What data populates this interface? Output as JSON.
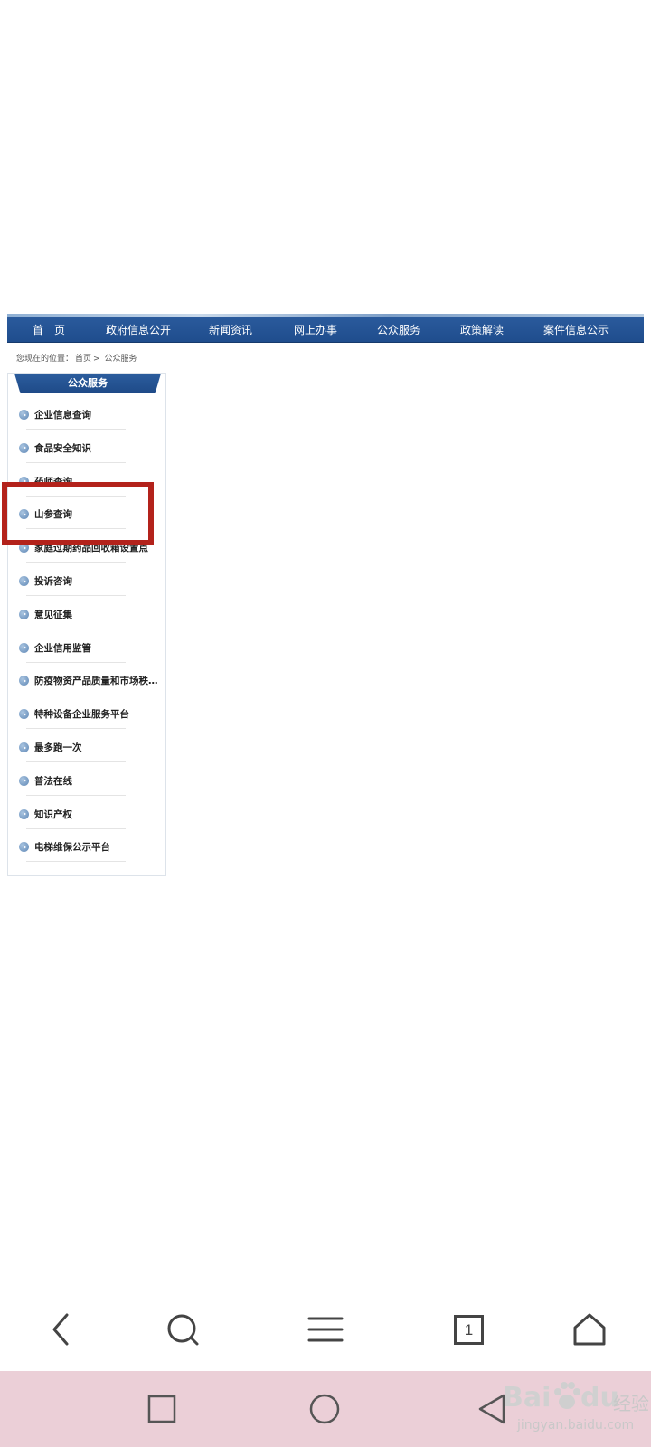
{
  "nav": {
    "items": [
      {
        "label": "首　页",
        "center": 54
      },
      {
        "label": "政府信息公开",
        "center": 153
      },
      {
        "label": "新闻资讯",
        "center": 255
      },
      {
        "label": "网上办事",
        "center": 349
      },
      {
        "label": "公众服务",
        "center": 441
      },
      {
        "label": "政策解读",
        "center": 533
      },
      {
        "label": "案件信息公示",
        "center": 637
      }
    ]
  },
  "breadcrumb": {
    "prefix": "您现在的位置：",
    "home": "首页",
    "sep": ">",
    "current": "公众服务"
  },
  "sidebar": {
    "title": "公众服务",
    "items": [
      {
        "label": "企业信息查询"
      },
      {
        "label": "食品安全知识"
      },
      {
        "label": "药师查询"
      },
      {
        "label": "山参查询"
      },
      {
        "label": "家庭过期药品回收箱设置点"
      },
      {
        "label": "投诉咨询"
      },
      {
        "label": "意见征集"
      },
      {
        "label": "企业信用监管"
      },
      {
        "label": "防疫物资产品质量和市场秩…"
      },
      {
        "label": "特种设备企业服务平台"
      },
      {
        "label": "最多跑一次"
      },
      {
        "label": "普法在线"
      },
      {
        "label": "知识产权"
      },
      {
        "label": "电梯维保公示平台"
      }
    ]
  },
  "browser_toolbar": {
    "tab_count": "1",
    "icons": [
      "back-icon",
      "search-icon",
      "menu-icon",
      "tabs-icon",
      "home-icon"
    ]
  },
  "system_nav": {
    "icons": [
      "recent-apps-icon",
      "home-circle-icon",
      "back-triangle-icon"
    ]
  },
  "watermark": {
    "brand": "Bai",
    "brand2": "du",
    "suffix": "经验",
    "url": "jingyan.baidu.com"
  },
  "colors": {
    "nav_blue": "#1f4d8d",
    "highlight_red": "#b3221b",
    "system_bar": "#ebcfd7"
  }
}
